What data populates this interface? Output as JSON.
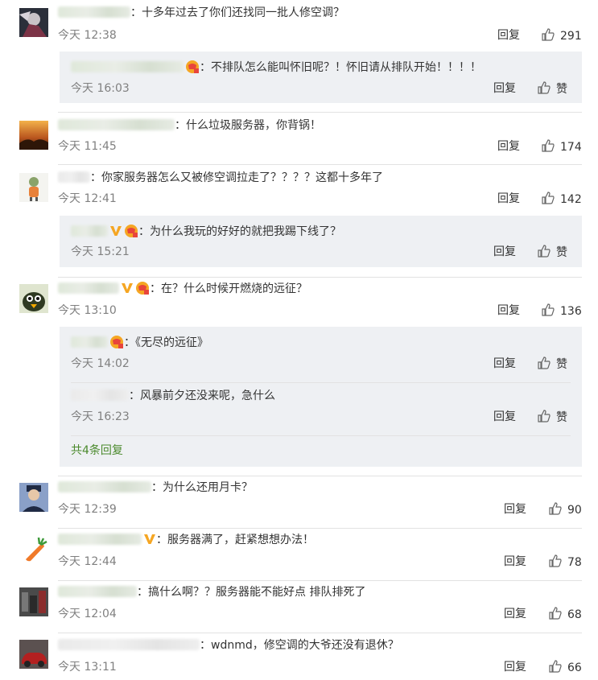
{
  "time_prefix": "今天",
  "reply_label": "回复",
  "like_label": "赞",
  "comments": [
    {
      "text": "：十多年过去了你们还找同一批人修空调？",
      "time": "今天 12:38",
      "likes": "291",
      "replies": [
        {
          "text": "：不排队怎么能叫怀旧呢？！怀旧请从排队开始！！！！",
          "time": "今天 16:03"
        }
      ]
    },
    {
      "text": "：什么垃圾服务器，你背锅！",
      "time": "今天 11:45",
      "likes": "174"
    },
    {
      "text": "：你家服务器怎么又被修空调拉走了？？？？这都十多年了",
      "time": "今天 12:41",
      "likes": "142",
      "replies": [
        {
          "text": "：为什么我玩的好好的就把我踢下线了？",
          "time": "今天 15:21"
        }
      ]
    },
    {
      "text": "：在？什么时候开燃烧的远征？",
      "time": "今天 13:10",
      "likes": "136",
      "replies": [
        {
          "text": "：《无尽的远征》",
          "time": "今天 14:02"
        },
        {
          "text": "：风暴前夕还没来呢，急什么",
          "time": "今天 16:23"
        }
      ],
      "more_replies": "共4条回复"
    },
    {
      "text": "：为什么还用月卡？",
      "time": "今天 12:39",
      "likes": "90"
    },
    {
      "text": "：服务器满了，赶紧想想办法！",
      "time": "今天 12:44",
      "likes": "78"
    },
    {
      "text": "：搞什么啊？？服务器能不能好点 排队排死了",
      "time": "今天 12:04",
      "likes": "68"
    },
    {
      "text": "：wdnmd，修空调的大爷还没有退休？",
      "time": "今天 13:11",
      "likes": "66"
    }
  ]
}
